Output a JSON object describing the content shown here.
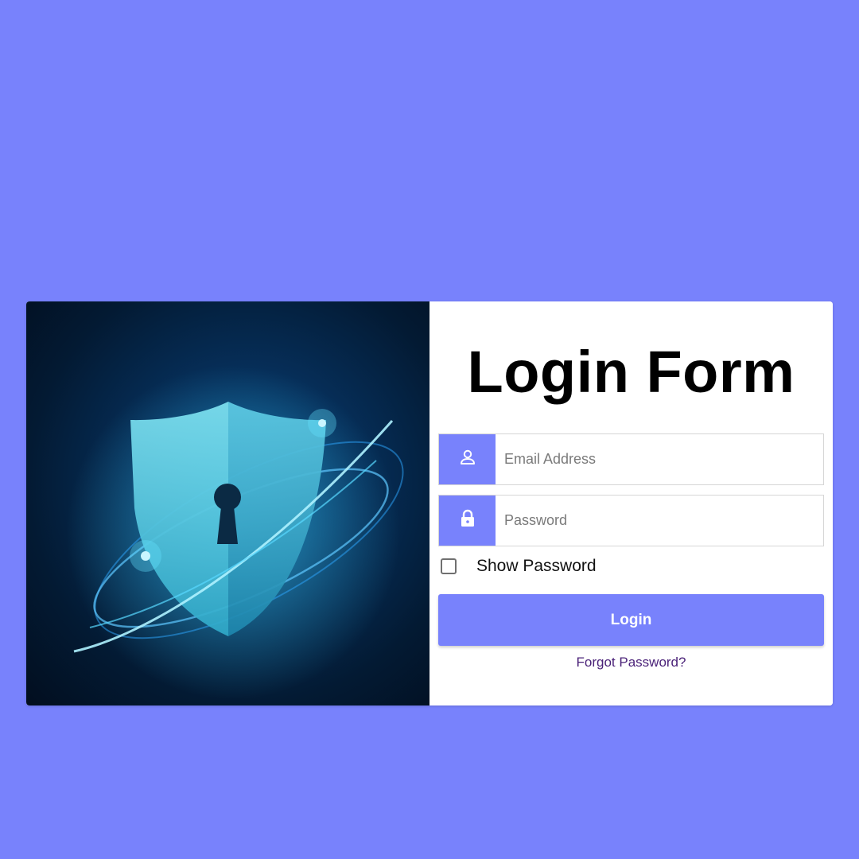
{
  "colors": {
    "background": "#7882fc",
    "accent": "#7882fc",
    "link": "#4a2178"
  },
  "illustration": {
    "description_icon": "shield-keyhole-icon"
  },
  "form": {
    "title": "Login Form",
    "email": {
      "placeholder": "Email Address",
      "value": "",
      "icon": "user-icon"
    },
    "password": {
      "placeholder": "Password",
      "value": "",
      "icon": "lock-icon"
    },
    "show_password": {
      "label": "Show Password",
      "checked": false
    },
    "login_label": "Login",
    "forgot_label": "Forgot Password?"
  }
}
